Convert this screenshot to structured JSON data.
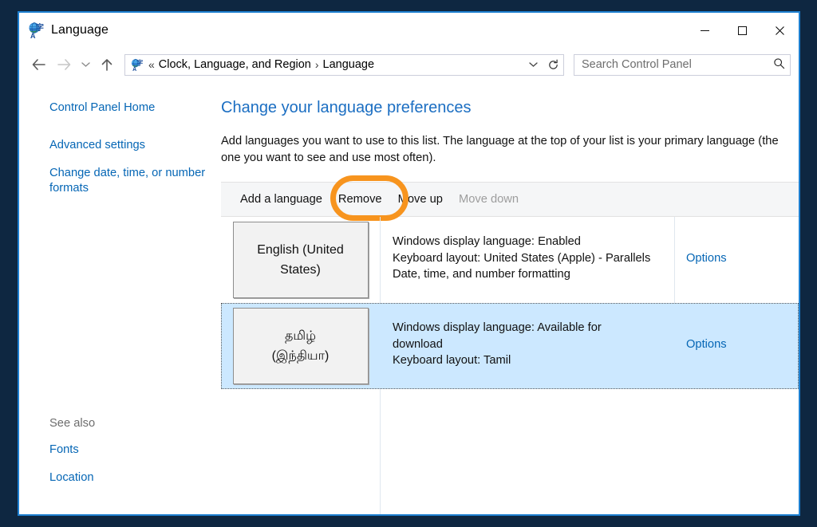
{
  "window": {
    "title": "Language",
    "icon": "language-globe-icon",
    "minimize_label": "—",
    "maximize_label": "□",
    "close_label": "✕",
    "border_color": "#1d7fd0",
    "desktop_background": "#0e2741"
  },
  "nav": {
    "back_label": "←",
    "forward_label": "→",
    "recent_label": "∨",
    "up_label": "↑",
    "address_icon": "language-globe-icon",
    "breadcrumb_prefix": "«",
    "crumbs": [
      "Clock, Language, and Region",
      "Language"
    ],
    "crumb_separator": "›",
    "dropdown_label": "∨",
    "refresh_label": "↻"
  },
  "search": {
    "placeholder": "Search Control Panel",
    "value": "",
    "icon": "search-icon"
  },
  "sidebar": {
    "items": [
      {
        "label": "Control Panel Home"
      },
      {
        "label": "Advanced settings"
      },
      {
        "label": "Change date, time, or number formats"
      }
    ],
    "see_also_label": "See also",
    "see_also_items": [
      {
        "label": "Fonts"
      },
      {
        "label": "Location"
      }
    ]
  },
  "main": {
    "title": "Change your language preferences",
    "description": "Add languages you want to use to this list. The language at the top of your list is your primary language (the one you want to see and use most often)."
  },
  "toolbar": {
    "buttons": [
      {
        "label": "Add a language",
        "disabled": false
      },
      {
        "label": "Remove",
        "disabled": false,
        "annotated": true
      },
      {
        "label": "Move up",
        "disabled": false
      },
      {
        "label": "Move down",
        "disabled": true
      }
    ],
    "annotation_color": "#f7941e"
  },
  "languages": [
    {
      "name_line1": "English (United",
      "name_line2": "States)",
      "detail_line1": "Windows display language: Enabled",
      "detail_line2": "Keyboard layout: United States (Apple) - Parallels",
      "detail_line3": "Date, time, and number formatting",
      "options_label": "Options",
      "selected": false
    },
    {
      "name_line1": "தமிழ்",
      "name_line2": "(இந்தியா)",
      "detail_line1": "Windows display language: Available for",
      "detail_line2": "download",
      "detail_line3": "Keyboard layout: Tamil",
      "options_label": "Options",
      "selected": true,
      "selection_color": "#cce8ff"
    }
  ]
}
